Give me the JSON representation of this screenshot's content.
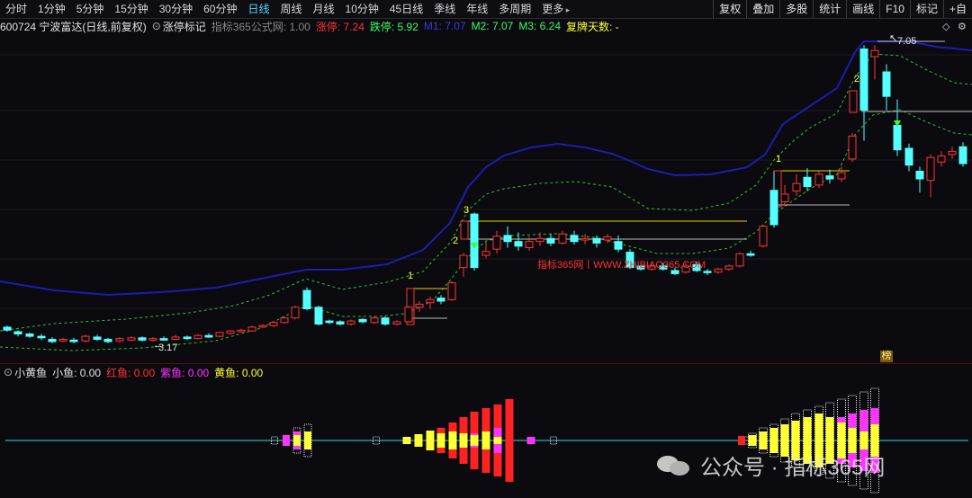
{
  "periods": [
    {
      "label": "分时",
      "active": false
    },
    {
      "label": "1分钟",
      "active": false
    },
    {
      "label": "5分钟",
      "active": false
    },
    {
      "label": "15分钟",
      "active": false
    },
    {
      "label": "30分钟",
      "active": false
    },
    {
      "label": "60分钟",
      "active": false
    },
    {
      "label": "日线",
      "active": true
    },
    {
      "label": "周线",
      "active": false
    },
    {
      "label": "月线",
      "active": false
    },
    {
      "label": "10分钟",
      "active": false
    },
    {
      "label": "45日线",
      "active": false
    },
    {
      "label": "季线",
      "active": false
    },
    {
      "label": "年线",
      "active": false
    },
    {
      "label": "多周期",
      "active": false
    },
    {
      "label": "更多",
      "active": false
    }
  ],
  "toolbar_right": [
    "复权",
    "叠加",
    "多股",
    "统计",
    "画线",
    "F10",
    "标记",
    "+自"
  ],
  "info": {
    "stock": "600724 宁波富达(日线,前复权)",
    "indicator": "涨停标记",
    "formula": "指标365公式网: 1.00",
    "zt": "涨停: 7.24",
    "dt": "跌停: 5.92",
    "m1": "M1: 7.07",
    "m2": "M2: 7.07",
    "m3": "M3: 6.24",
    "fp": "复牌天数: -"
  },
  "chart_labels": {
    "high": "7.05",
    "low": "3.17",
    "site": "指标365网丨WWW.ZHIBIAO365.COM",
    "bang": "榜",
    "nums": [
      "1",
      "2",
      "3",
      "1",
      "2"
    ]
  },
  "sub": {
    "name": "小黄鱼",
    "xiaoyu": "小鱼: 0.00",
    "hongyu": "红鱼: 0.00",
    "ziyu": "紫鱼: 0.00",
    "huangyu": "黄鱼: 0.00"
  },
  "watermark": "公众号 · 指标365网",
  "colors": {
    "up": "#ff3333",
    "down": "#54ffff",
    "band": "#1c1cb0",
    "dash": "#2fbf2f",
    "yellow": "#ffff33",
    "magenta": "#ff33ff",
    "cyan": "#39d8d8"
  }
}
